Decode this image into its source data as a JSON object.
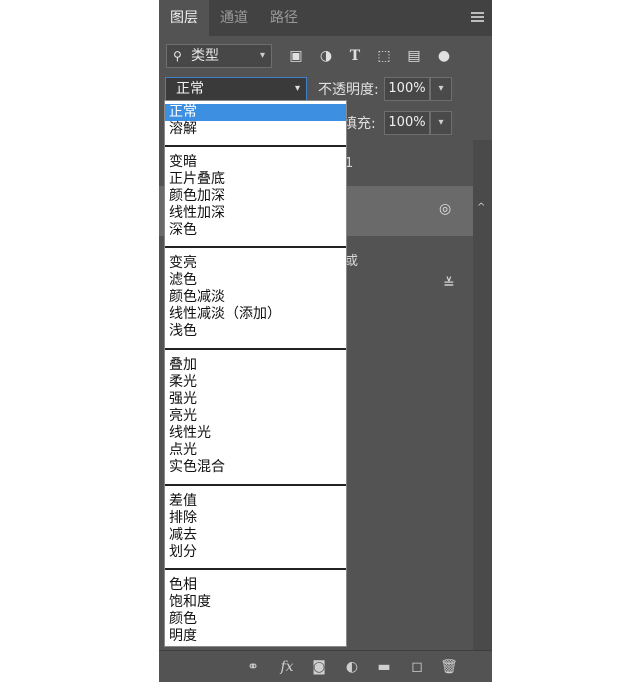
{
  "tabs": [
    "图层",
    "通道",
    "路径"
  ],
  "filter": {
    "label": "类型"
  },
  "filter_icons": [
    "pixel-filter-icon",
    "adjustment-filter-icon",
    "type-filter-icon",
    "shape-filter-icon",
    "smart-object-filter-icon",
    "filter-toggle-icon"
  ],
  "blend": {
    "value": "正常"
  },
  "opacity": {
    "label": "不透明度:",
    "value": "100%"
  },
  "fill": {
    "label": "填充:",
    "value": "100%"
  },
  "layers_partial": {
    "row1_tail": "1",
    "row3_tail": "或"
  },
  "dropdown": {
    "items": [
      "正常",
      "溶解",
      "变暗",
      "正片叠底",
      "颜色加深",
      "线性加深",
      "深色",
      "变亮",
      "滤色",
      "颜色减淡",
      "线性减淡（添加）",
      "浅色",
      "叠加",
      "柔光",
      "强光",
      "亮光",
      "线性光",
      "点光",
      "实色混合",
      "差值",
      "排除",
      "减去",
      "划分",
      "色相",
      "饱和度",
      "颜色",
      "明度"
    ]
  },
  "bottom_icons": [
    "link-layers-icon",
    "fx-icon",
    "mask-icon",
    "adjustment-layer-icon",
    "group-folder-icon",
    "new-layer-icon",
    "trash-icon"
  ],
  "bottom_fx": "fx",
  "colors": {
    "panel": "#535353",
    "tabbar": "#424242",
    "selection": "#3c8fe1",
    "accent_border": "#3f80c8"
  }
}
